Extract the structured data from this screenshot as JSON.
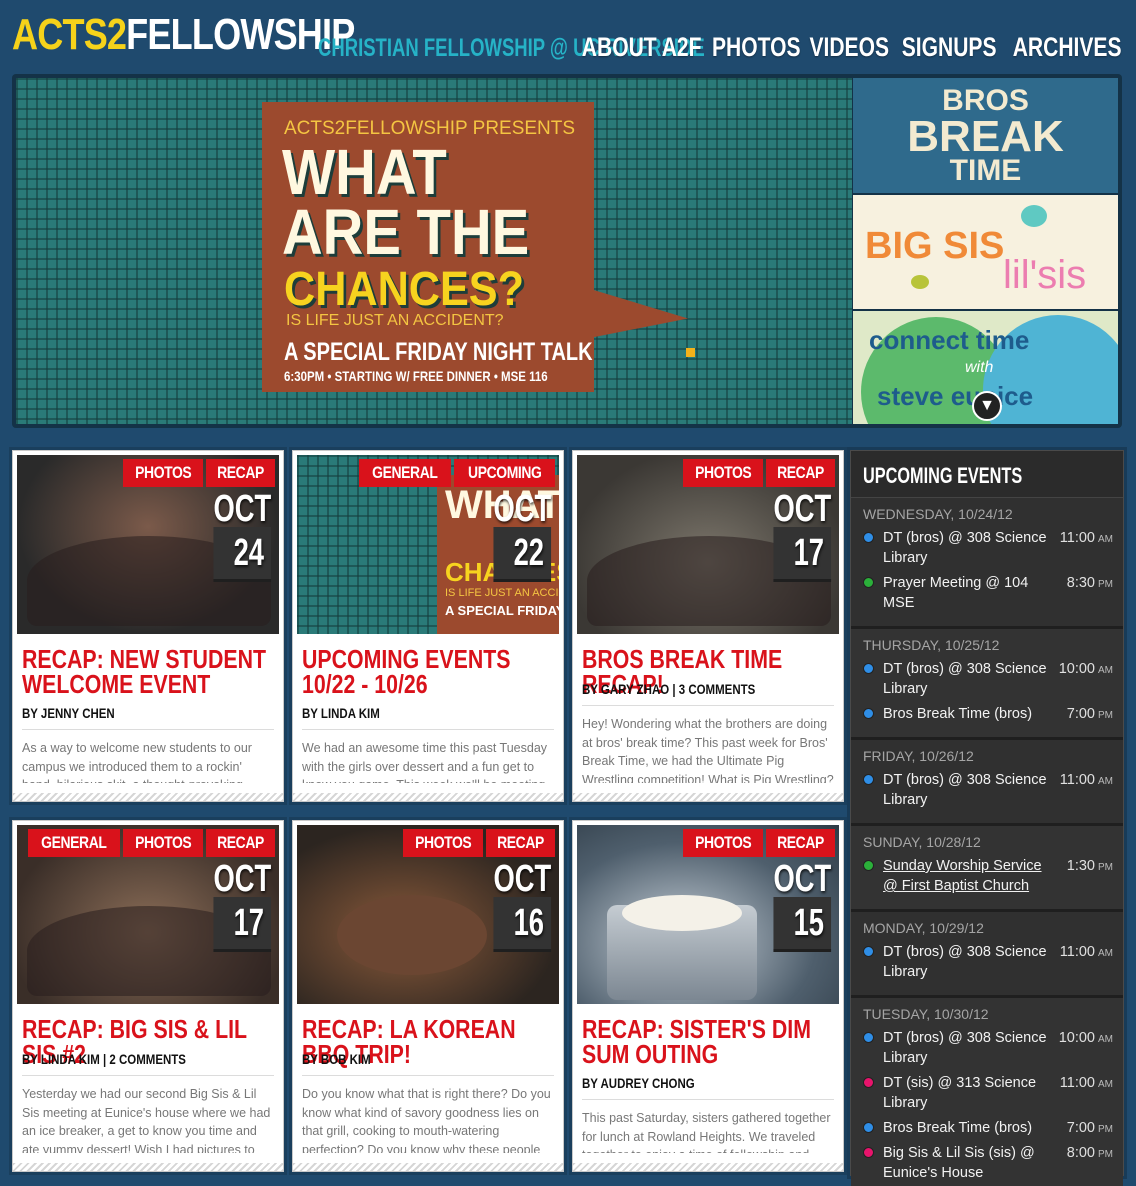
{
  "header": {
    "logo_part1": "ACTS2",
    "logo_part2": "FELLOWSHIP",
    "tagline": "CHRISTIAN FELLOWSHIP @ UC RIVERSIDE",
    "nav": [
      "ABOUT A2F",
      "PHOTOS",
      "VIDEOS",
      "SIGNUPS",
      "ARCHIVES"
    ]
  },
  "hero": {
    "poster_presents": "ACTS2FELLOWSHIP PRESENTS",
    "poster_line1": "WHAT",
    "poster_line2": "ARE THE",
    "poster_line3": "CHANCES?",
    "poster_sub": "IS LIFE JUST AN ACCIDENT?",
    "poster_talk": "A SPECIAL FRIDAY NIGHT TALK",
    "poster_details": "6:30PM • STARTING W/ FREE DINNER • MSE 116",
    "side1": {
      "line1": "BROS",
      "line2": "BREAK",
      "line3": "TIME"
    },
    "side2": {
      "line1": "BIG SIS",
      "line2": "lil'sis"
    },
    "side3": {
      "line1": "connect time",
      "line2": "with",
      "line3": "steve eunice"
    },
    "scroll_icon": "down-arrow-icon"
  },
  "posts": [
    {
      "tags": [
        "PHOTOS",
        "RECAP"
      ],
      "month": "OCT",
      "day": "24",
      "title": "RECAP: NEW STUDENT WELCOME EVENT",
      "byline": "BY JENNY CHEN",
      "excerpt": "As a way to welcome new students to our campus we introduced them to a rockin' band, hilarious skit, a thought-provoking message"
    },
    {
      "tags": [
        "GENERAL",
        "UPCOMING"
      ],
      "month": "OCT",
      "day": "22",
      "title": "UPCOMING EVENTS 10/22 - 10/26",
      "byline": "BY LINDA KIM",
      "excerpt": "We had an awesome time this past Tuesday with the girls over dessert and a fun get to know you game. This week we'll be meeting at"
    },
    {
      "tags": [
        "PHOTOS",
        "RECAP"
      ],
      "month": "OCT",
      "day": "17",
      "title": "BROS BREAK TIME RECAP!",
      "byline": "BY GARY ZHAO | 3 COMMENTS",
      "excerpt": "Hey! Wondering what the brothers are doing at bros' break time? This past week for Bros' Break Time, we had the Ultimate Pig Wrestling competition! What is Pig Wrestling? The"
    },
    {
      "tags": [
        "GENERAL",
        "PHOTOS",
        "RECAP"
      ],
      "month": "OCT",
      "day": "17",
      "title": "RECAP: BIG SIS & LIL SIS #2",
      "byline": "BY LINDA KIM | 2 COMMENTS",
      "excerpt": "Yesterday we had our second Big Sis & Lil Sis meeting at Eunice's house where we had an ice breaker, a get to know you time and ate yummy dessert! Wish I had pictures to show you but"
    },
    {
      "tags": [
        "PHOTOS",
        "RECAP"
      ],
      "month": "OCT",
      "day": "16",
      "title": "RECAP: LA KOREAN BBQ TRIP!",
      "byline": "BY BOB KIM",
      "excerpt": "Do you know what that is right there? Do you know what kind of savory goodness lies on that grill, cooking to mouth-watering perfection? Do you know why these people"
    },
    {
      "tags": [
        "PHOTOS",
        "RECAP"
      ],
      "month": "OCT",
      "day": "15",
      "title": "RECAP: SISTER'S DIM SUM OUTING",
      "byline": "BY AUDREY CHONG",
      "excerpt": "This past Saturday, sisters gathered together for lunch at Rowland Heights. We traveled together to enjoy a time of fellowship and"
    }
  ],
  "sidebar": {
    "title": "UPCOMING EVENTS",
    "days": [
      {
        "label": "WEDNESDAY, 10/24/12",
        "events": [
          {
            "title": "DT (bros) @ 308 Science Library",
            "time": "11:00",
            "ampm": "AM",
            "color": "#2f8ee6",
            "link": false
          },
          {
            "title": "Prayer Meeting @ 104 MSE",
            "time": "8:30",
            "ampm": "PM",
            "color": "#2bb03a",
            "link": false
          }
        ]
      },
      {
        "label": "THURSDAY, 10/25/12",
        "events": [
          {
            "title": "DT (bros) @ 308 Science Library",
            "time": "10:00",
            "ampm": "AM",
            "color": "#2f8ee6",
            "link": false
          },
          {
            "title": "Bros Break Time (bros)",
            "time": "7:00",
            "ampm": "PM",
            "color": "#2f8ee6",
            "link": false
          }
        ]
      },
      {
        "label": "FRIDAY, 10/26/12",
        "events": [
          {
            "title": "DT (bros) @ 308 Science Library",
            "time": "11:00",
            "ampm": "AM",
            "color": "#2f8ee6",
            "link": false
          }
        ]
      },
      {
        "label": "SUNDAY, 10/28/12",
        "events": [
          {
            "title": "Sunday Worship Service @ First Baptist Church",
            "time": "1:30",
            "ampm": "PM",
            "color": "#2bb03a",
            "link": true
          }
        ]
      },
      {
        "label": "MONDAY, 10/29/12",
        "events": [
          {
            "title": "DT (bros) @ 308 Science Library",
            "time": "11:00",
            "ampm": "AM",
            "color": "#2f8ee6",
            "link": false
          }
        ]
      },
      {
        "label": "TUESDAY, 10/30/12",
        "events": [
          {
            "title": "DT (bros) @ 308 Science Library",
            "time": "10:00",
            "ampm": "AM",
            "color": "#2f8ee6",
            "link": false
          },
          {
            "title": "DT (sis) @ 313 Science Library",
            "time": "11:00",
            "ampm": "AM",
            "color": "#e8146c",
            "link": false
          },
          {
            "title": "Bros Break Time (bros)",
            "time": "7:00",
            "ampm": "PM",
            "color": "#2f8ee6",
            "link": false
          },
          {
            "title": "Big Sis & Lil Sis (sis) @ Eunice's House",
            "time": "8:00",
            "ampm": "PM",
            "color": "#e8146c",
            "link": false
          }
        ]
      }
    ]
  },
  "colors": {
    "background": "#1f4a6e",
    "accent_red": "#d9121b",
    "logo_yellow": "#f6d21a",
    "tagline_teal": "#26b3c7"
  }
}
